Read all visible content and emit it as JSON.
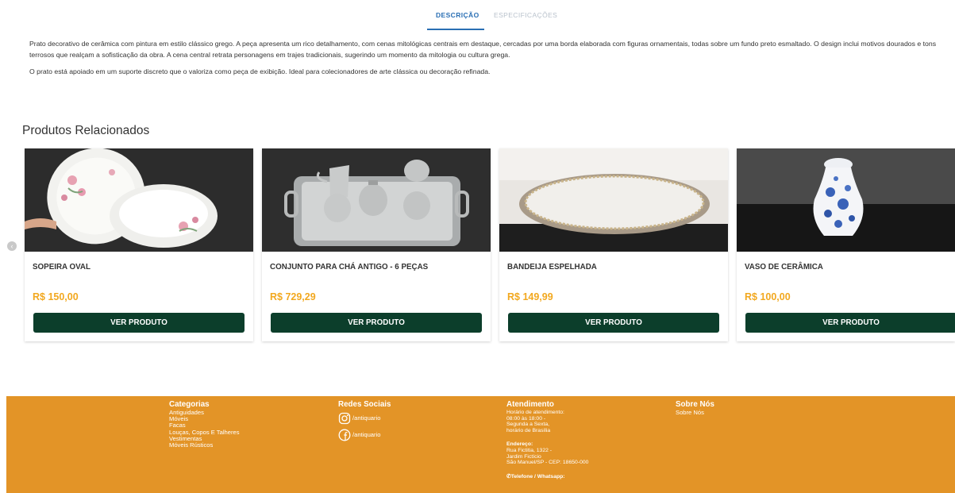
{
  "tabs": [
    {
      "label": "DESCRIÇÃO"
    },
    {
      "label": "ESPECIFICAÇÕES"
    }
  ],
  "description": {
    "p1": "Prato decorativo de cerâmica com pintura em estilo clássico grego. A peça apresenta um rico detalhamento, com cenas mitológicas centrais em destaque, cercadas por uma borda elaborada com figuras ornamentais, todas sobre um fundo preto esmaltado. O design inclui motivos dourados e tons terrosos que realçam a sofisticação da obra. A cena central retrata personagens em trajes tradicionais, sugerindo um momento da mitologia ou cultura grega.",
    "p2": "O prato está apoiado em um suporte discreto que o valoriza como peça de exibição. Ideal para colecionadores de arte clássica ou decoração refinada."
  },
  "related": {
    "title": "Produtos Relacionados",
    "prev_icon": "chevron-left-icon",
    "products": [
      {
        "name": "SOPEIRA OVAL",
        "price": "R$ 150,00",
        "button": "VER PRODUTO",
        "image": "soup-tureen-photo"
      },
      {
        "name": "CONJUNTO PARA CHÁ ANTIGO - 6 PEÇAS",
        "price": "R$ 729,29",
        "button": "VER PRODUTO",
        "image": "silver-tea-set-photo"
      },
      {
        "name": "BANDEIJA ESPELHADA",
        "price": "R$ 149,99",
        "button": "VER PRODUTO",
        "image": "mirrored-tray-photo"
      },
      {
        "name": "VASO DE CERÂMICA",
        "price": "R$ 100,00",
        "button": "VER PRODUTO",
        "image": "ceramic-vase-photo"
      }
    ]
  },
  "footer": {
    "categories": {
      "title": "Categorias",
      "items": [
        "Antiguidades",
        "Móveis",
        "Facas",
        "Louças, Copos E Talheres",
        "Vestimentas",
        "Móveis Rústicos"
      ]
    },
    "social": {
      "title": "Redes Sociais",
      "instagram": "/antiquario",
      "facebook": "/antiquario"
    },
    "service": {
      "title": "Atendimento",
      "hours_lines": [
        "Horário de atendimento:",
        "08:00 às 18:00 -",
        "Segunda a Sexta,",
        "horário de Brasília"
      ],
      "address_title": "Endereço:",
      "address_lines": [
        "Rua Fictitia, 1322 -",
        "Jardim Fictício",
        "São Manuel/SP - CEP: 18650-000"
      ],
      "phone_label": "Telefone / Whatsapp:"
    },
    "about": {
      "title": "Sobre Nós",
      "link": "Sobre Nós"
    }
  },
  "colors": {
    "accent_tab": "#2a6fb4",
    "price": "#f2a81f",
    "button": "#0c3e2b",
    "footer": "#e39427"
  }
}
